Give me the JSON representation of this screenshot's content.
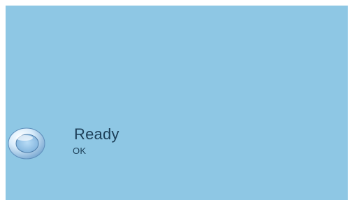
{
  "status": {
    "title": "Ready",
    "subtitle": "OK",
    "icon": "ring-icon"
  },
  "colors": {
    "background": "#8ec7e4",
    "text": "#1d3f58"
  }
}
